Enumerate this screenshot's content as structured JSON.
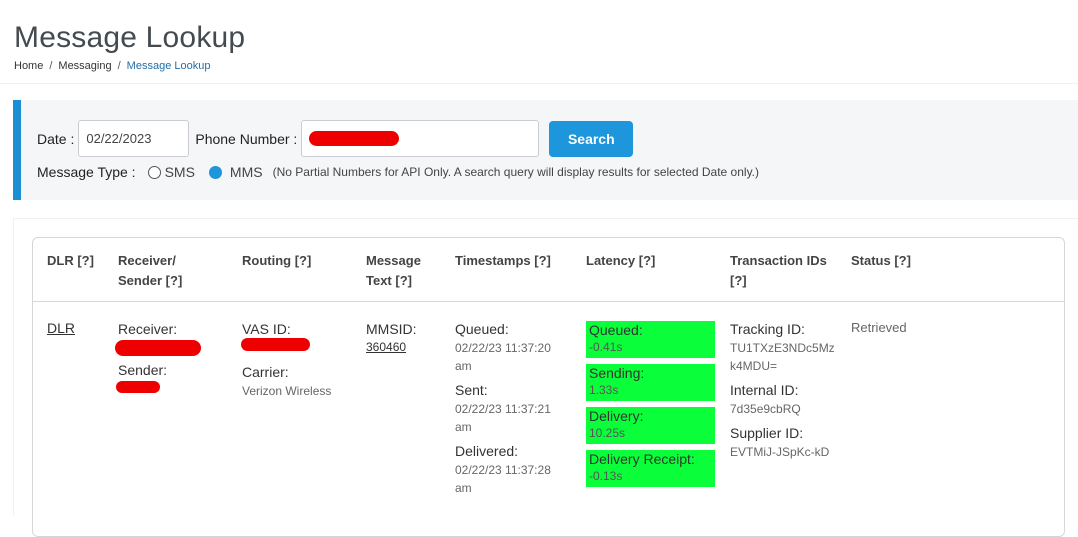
{
  "header": {
    "title": "Message Lookup",
    "breadcrumb": [
      "Home",
      "Messaging",
      "Message Lookup"
    ],
    "breadcrumb_separator": "/"
  },
  "filters": {
    "date_label": "Date :",
    "date_value": "02/22/2023",
    "phone_label": "Phone Number :",
    "search_label": "Search",
    "message_type_label": "Message Type :",
    "sms_label": "SMS",
    "mms_label": "MMS",
    "selected_type": "MMS",
    "hint": "(No Partial Numbers for API Only. A search query will display results for selected Date only.)"
  },
  "table": {
    "headers": {
      "dlr": "DLR [?]",
      "receiver_1": "Receiver/",
      "receiver_2": "Sender [?]",
      "routing": "Routing [?]",
      "message_1": "Message",
      "message_2": "Text [?]",
      "timestamps": "Timestamps [?]",
      "latency": "Latency [?]",
      "transactions_1": "Transaction IDs",
      "transactions_2": "[?]",
      "status": "Status [?]"
    },
    "row": {
      "dlr_link": "DLR",
      "receiver_label": "Receiver:",
      "sender_label": "Sender:",
      "vas_label": "VAS ID:",
      "carrier_label": "Carrier:",
      "carrier_value": "Verizon Wireless",
      "mmsid_label": "MMSID:",
      "mmsid_value": "360460",
      "queued_label": "Queued:",
      "queued_date": "02/22/23 11:37:20",
      "queued_ampm": "am",
      "sent_label": "Sent:",
      "sent_date": "02/22/23 11:37:21",
      "sent_ampm": "am",
      "delivered_label": "Delivered:",
      "delivered_date": "02/22/23 11:37:28",
      "delivered_ampm": "am",
      "latency": [
        {
          "label": "Queued:",
          "value": "-0.41s"
        },
        {
          "label": "Sending:",
          "value": "1.33s"
        },
        {
          "label": "Delivery:",
          "value": "10.25s"
        },
        {
          "label": "Delivery Receipt:",
          "value": "-0.13s"
        }
      ],
      "tracking_label": "Tracking ID:",
      "tracking_value_1": "TU1TXzE3NDc5Mz",
      "tracking_value_2": "k4MDU=",
      "internal_label": "Internal ID:",
      "internal_value": "7d35e9cbRQ",
      "supplier_label": "Supplier ID:",
      "supplier_value": "EVTMiJ-JSpKc-kD",
      "status": "Retrieved"
    }
  },
  "colors": {
    "accent": "#1e96dc",
    "latency_fill": "#0aff3a",
    "redaction": "#ee0000",
    "breadcrumb_active": "#1f6fa8"
  }
}
